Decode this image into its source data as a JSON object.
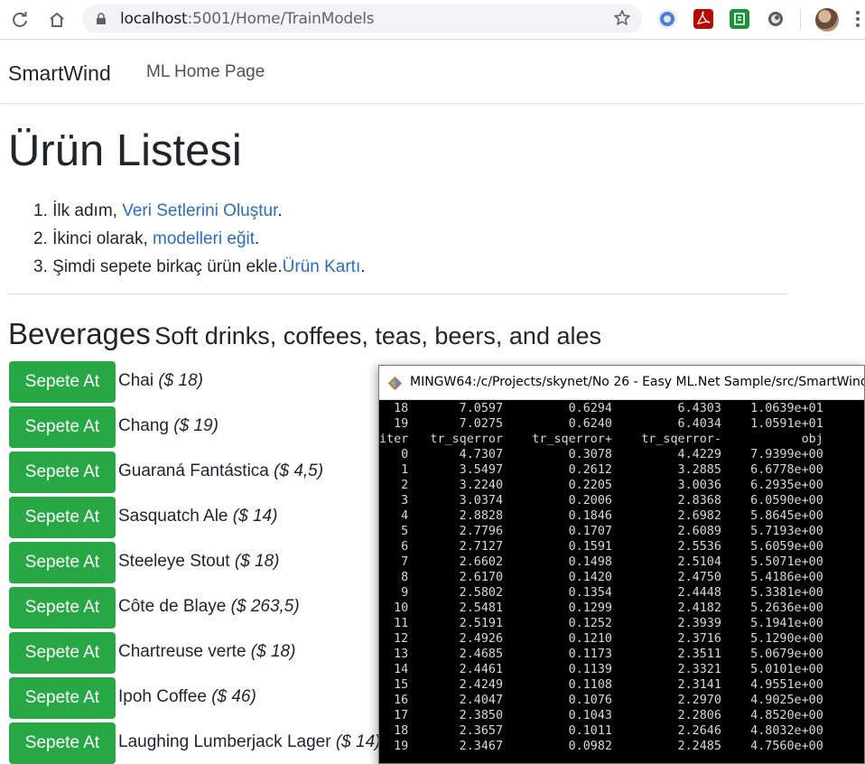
{
  "browser": {
    "url_host": "localhost",
    "url_path": ":5001/Home/TrainModels"
  },
  "navbar": {
    "brand": "SmartWind",
    "link": "ML Home Page"
  },
  "page": {
    "title": "Ürün Listesi",
    "steps": [
      {
        "num": "1.",
        "prefix": "İlk adım, ",
        "link": "Veri Setlerini Oluştur",
        "suffix": "."
      },
      {
        "num": "2.",
        "prefix": "İkinci olarak, ",
        "link": "modelleri eğit",
        "suffix": "."
      },
      {
        "num": "3.",
        "prefix": "Şimdi sepete birkaç ürün ekle.",
        "link": "Ürün Kartı",
        "suffix": "."
      }
    ],
    "category_name": "Beverages",
    "category_desc": "Soft drinks, coffees, teas, beers, and ales",
    "add_button_label": "Sepete At",
    "products": [
      {
        "name": "Chai",
        "price": "($ 18)"
      },
      {
        "name": "Chang",
        "price": "($ 19)"
      },
      {
        "name": "Guaraná Fantástica",
        "price": "($ 4,5)"
      },
      {
        "name": "Sasquatch Ale",
        "price": "($ 14)"
      },
      {
        "name": "Steeleye Stout",
        "price": "($ 18)"
      },
      {
        "name": "Côte de Blaye",
        "price": "($ 263,5)"
      },
      {
        "name": "Chartreuse verte",
        "price": "($ 18)"
      },
      {
        "name": "Ipoh Coffee",
        "price": "($ 46)"
      },
      {
        "name": "Laughing Lumberjack Lager",
        "price": "($ 14)"
      }
    ]
  },
  "terminal": {
    "title": "MINGW64:/c/Projects/skynet/No 26 - Easy ML.Net Sample/src/SmartWind",
    "header": [
      "iter",
      "tr_sqerror",
      "tr_sqerror+",
      "tr_sqerror-",
      "obj"
    ],
    "pre_rows": [
      [
        "18",
        "7.0597",
        "0.6294",
        "6.4303",
        "1.0639e+01"
      ],
      [
        "19",
        "7.0275",
        "0.6240",
        "6.4034",
        "1.0591e+01"
      ]
    ],
    "rows": [
      [
        "0",
        "4.7307",
        "0.3078",
        "4.4229",
        "7.9399e+00"
      ],
      [
        "1",
        "3.5497",
        "0.2612",
        "3.2885",
        "6.6778e+00"
      ],
      [
        "2",
        "3.2240",
        "0.2205",
        "3.0036",
        "6.2935e+00"
      ],
      [
        "3",
        "3.0374",
        "0.2006",
        "2.8368",
        "6.0590e+00"
      ],
      [
        "4",
        "2.8828",
        "0.1846",
        "2.6982",
        "5.8645e+00"
      ],
      [
        "5",
        "2.7796",
        "0.1707",
        "2.6089",
        "5.7193e+00"
      ],
      [
        "6",
        "2.7127",
        "0.1591",
        "2.5536",
        "5.6059e+00"
      ],
      [
        "7",
        "2.6602",
        "0.1498",
        "2.5104",
        "5.5071e+00"
      ],
      [
        "8",
        "2.6170",
        "0.1420",
        "2.4750",
        "5.4186e+00"
      ],
      [
        "9",
        "2.5802",
        "0.1354",
        "2.4448",
        "5.3381e+00"
      ],
      [
        "10",
        "2.5481",
        "0.1299",
        "2.4182",
        "5.2636e+00"
      ],
      [
        "11",
        "2.5191",
        "0.1252",
        "2.3939",
        "5.1941e+00"
      ],
      [
        "12",
        "2.4926",
        "0.1210",
        "2.3716",
        "5.1290e+00"
      ],
      [
        "13",
        "2.4685",
        "0.1173",
        "2.3511",
        "5.0679e+00"
      ],
      [
        "14",
        "2.4461",
        "0.1139",
        "2.3321",
        "5.0101e+00"
      ],
      [
        "15",
        "2.4249",
        "0.1108",
        "2.3141",
        "4.9551e+00"
      ],
      [
        "16",
        "2.4047",
        "0.1076",
        "2.2970",
        "4.9025e+00"
      ],
      [
        "17",
        "2.3850",
        "0.1043",
        "2.2806",
        "4.8520e+00"
      ],
      [
        "18",
        "2.3657",
        "0.1011",
        "2.2646",
        "4.8032e+00"
      ],
      [
        "19",
        "2.3467",
        "0.0982",
        "2.2485",
        "4.7560e+00"
      ]
    ]
  },
  "colors": {
    "button_green": "#28a745",
    "link_blue": "#2a6ebb",
    "terminal_bg": "#000000"
  }
}
